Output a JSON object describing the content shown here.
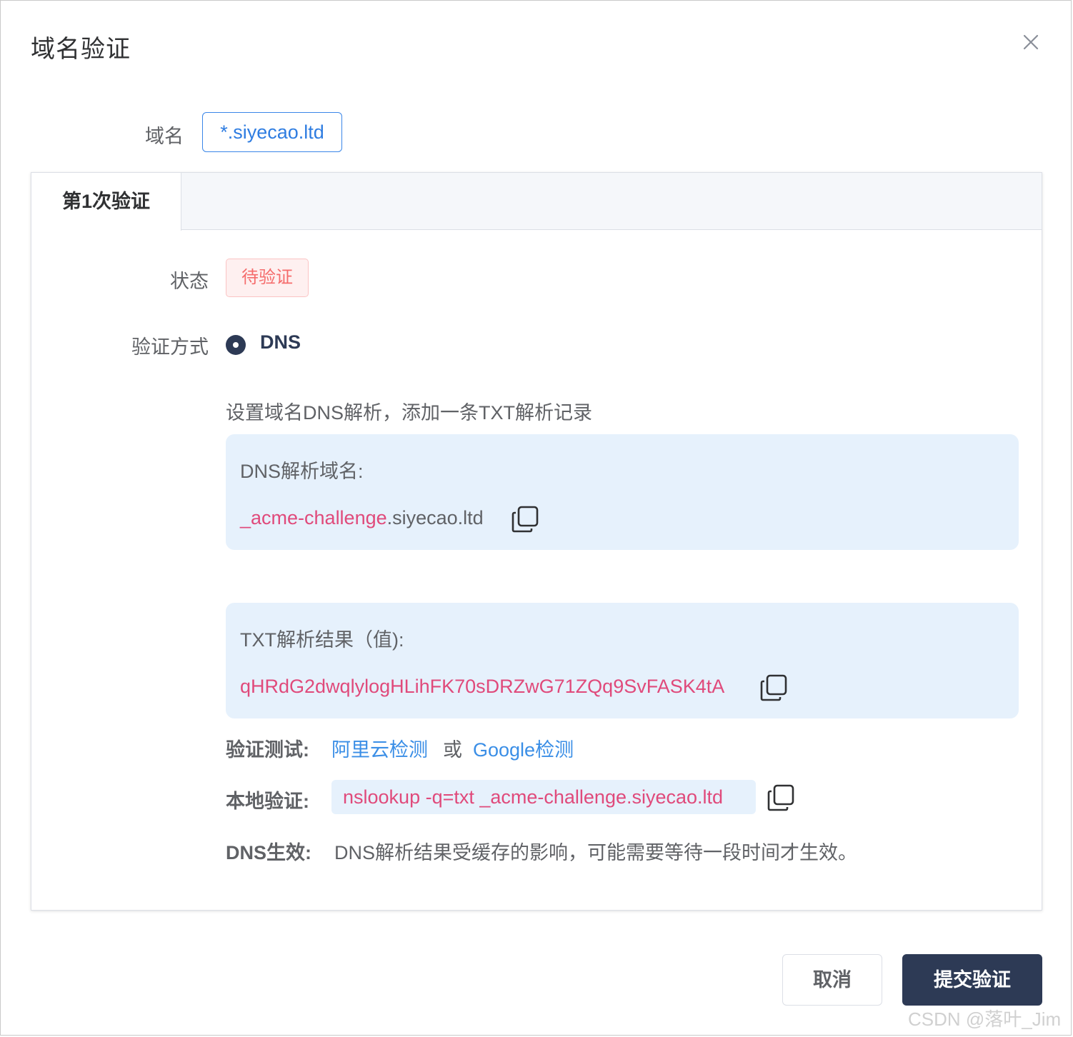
{
  "dialog": {
    "title": "域名验证",
    "close_icon": "close-icon"
  },
  "domain": {
    "label": "域名",
    "value": "*.siyecao.ltd"
  },
  "tabs": [
    {
      "label": "第1次验证",
      "active": true
    }
  ],
  "status": {
    "label": "状态",
    "value": "待验证"
  },
  "method": {
    "label": "验证方式",
    "selected": "DNS"
  },
  "description": "设置域名DNS解析，添加一条TXT解析记录",
  "dns_record": {
    "title": "DNS解析域名:",
    "prefix": "_acme-challenge",
    "suffix": ".siyecao.ltd"
  },
  "txt_record": {
    "title": "TXT解析结果（值):",
    "value": "qHRdG2dwqlylogHLihFK70sDRZwG71ZQq9SvFASK4tA"
  },
  "verify_test": {
    "label": "验证测试:",
    "aliyun_link": "阿里云检测",
    "or": "或",
    "google_link": "Google检测"
  },
  "local_verify": {
    "label": "本地验证:",
    "command": "nslookup -q=txt _acme-challenge.siyecao.ltd"
  },
  "dns_effect": {
    "label": "DNS生效:",
    "text": "DNS解析结果受缓存的影响，可能需要等待一段时间才生效。"
  },
  "footer": {
    "cancel_label": "取消",
    "submit_label": "提交验证"
  },
  "watermark": "CSDN @落叶_Jim",
  "colors": {
    "primary_dark": "#2d3a55",
    "link_blue": "#3a8ee6",
    "code_pink": "#e04a7b",
    "info_bg": "#e6f1fc",
    "status_red": "#f56c6c"
  }
}
